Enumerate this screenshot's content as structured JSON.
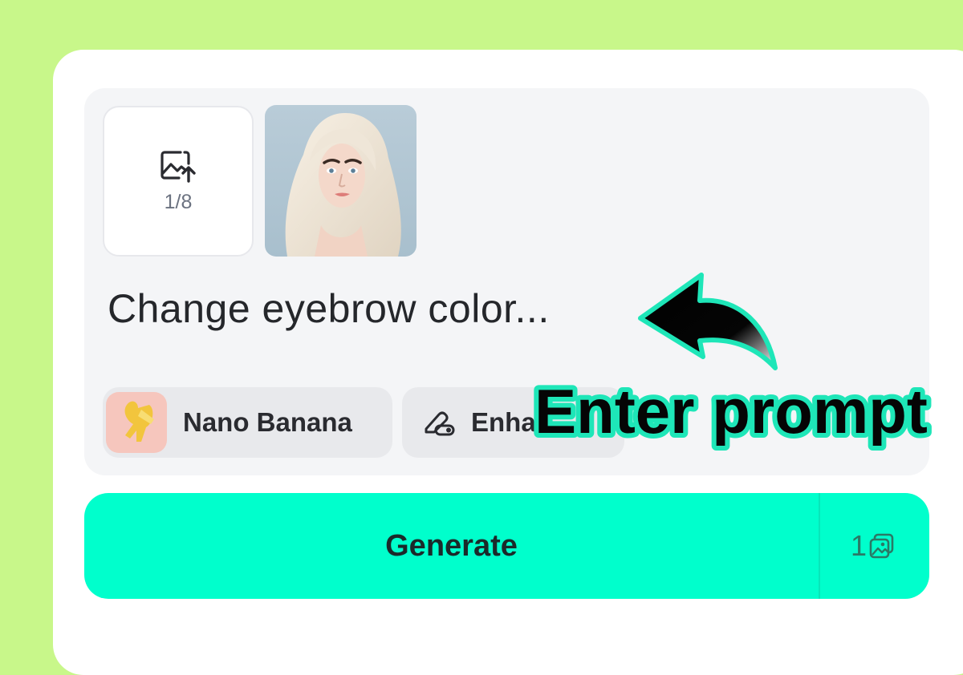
{
  "upload": {
    "count": "1/8",
    "icon": "image-upload-icon"
  },
  "reference_image": {
    "alt": "blonde-portrait"
  },
  "prompt": {
    "placeholder": "Change eyebrow color..."
  },
  "model_chip": {
    "label": "Nano Banana",
    "icon": "banana-figure-thumbnail"
  },
  "enhance_chip": {
    "label": "Enha",
    "icon": "pen-toggle-icon"
  },
  "generate": {
    "label": "Generate",
    "credits": "1",
    "credits_icon": "images-icon"
  },
  "callout": {
    "text": "Enter prompt"
  },
  "colors": {
    "background": "#c8f78a",
    "accent": "#00ffcc",
    "callout_stroke": "#1ee6b8",
    "text": "#25272b"
  }
}
